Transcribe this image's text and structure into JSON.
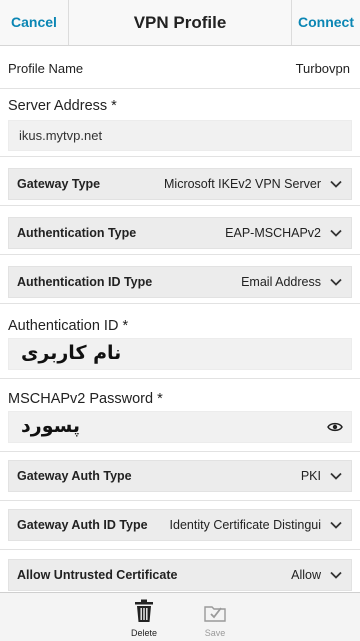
{
  "titlebar": {
    "cancel_label": "Cancel",
    "title": "VPN Profile",
    "connect_label": "Connect"
  },
  "profile_name": {
    "label": "Profile Name",
    "value": "Turbovpn"
  },
  "server_address": {
    "label": "Server Address *",
    "value": "ikus.mytvp.net"
  },
  "gateway_type": {
    "label": "Gateway Type",
    "value": "Microsoft IKEv2 VPN Server"
  },
  "authentication_type": {
    "label": "Authentication Type",
    "value": "EAP-MSCHAPv2"
  },
  "authentication_id_type": {
    "label": "Authentication ID Type",
    "value": "Email Address"
  },
  "authentication_id": {
    "label": "Authentication ID *",
    "value": "نام کاربری"
  },
  "password": {
    "label": "MSCHAPv2 Password *",
    "value": "پسورد"
  },
  "gateway_auth_type": {
    "label": "Gateway Auth Type",
    "value": "PKI"
  },
  "gateway_auth_id_type": {
    "label": "Gateway Auth ID Type",
    "value": "Identity Certificate Distingui"
  },
  "allow_untrusted_certificate": {
    "label": "Allow Untrusted Certificate",
    "value": "Allow"
  },
  "bottombar": {
    "delete_label": "Delete",
    "save_label": "Save"
  },
  "icons": {
    "dropdown": "chevron-down-icon",
    "reveal_password": "eye-icon",
    "delete": "trash-icon",
    "save": "save-icon"
  },
  "colors": {
    "accent": "#0b86b4"
  }
}
